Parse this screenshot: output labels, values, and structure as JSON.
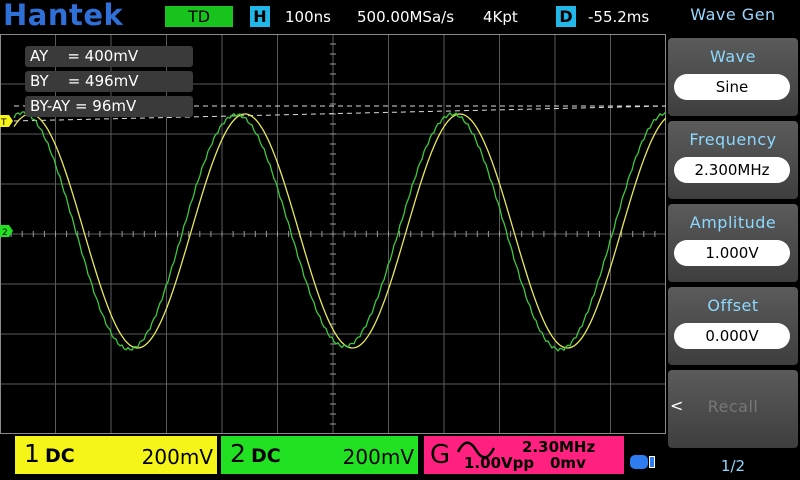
{
  "topbar": {
    "logo": "Hantek",
    "trigger_mode": "TD",
    "timebase_tag": "H",
    "timebase": "100ns",
    "sample_rate": "500.00MSa/s",
    "memory_depth": "4Kpt",
    "delay_tag": "D",
    "delay": "-55.2ms"
  },
  "markers": {
    "trigger": "T",
    "ch2": "2"
  },
  "cursor": {
    "ay": "AY    = 400mV",
    "by": "BY    = 496mV",
    "diff": "BY-AY = 96mV"
  },
  "bottom": {
    "ch1": {
      "num": "1",
      "coupling": "DC",
      "scale": "200mV",
      "color": "#f5f51a"
    },
    "ch2": {
      "num": "2",
      "coupling": "DC",
      "scale": "200mV",
      "color": "#22e022"
    },
    "gen": {
      "label": "G",
      "waveform": "sine-icon",
      "frequency": "2.30MHz",
      "amplitude": "1.00Vpp",
      "offset": "0mv",
      "color": "#ff2080"
    }
  },
  "side_menu": {
    "title": "Wave Gen",
    "items": [
      {
        "label": "Wave",
        "value": "Sine"
      },
      {
        "label": "Frequency",
        "value": "2.300MHz"
      },
      {
        "label": "Amplitude",
        "value": "1.000V"
      },
      {
        "label": "Offset",
        "value": "0.000V"
      }
    ],
    "recall_label": "Recall",
    "recall_arrow": "<",
    "page": "1/2"
  },
  "colors": {
    "logo": "#2f6fd8",
    "accent_cyan": "#21b7e8",
    "trace1": "#e8e85a",
    "trace2": "#3ec83e",
    "menu_label": "#8dd8ff"
  }
}
